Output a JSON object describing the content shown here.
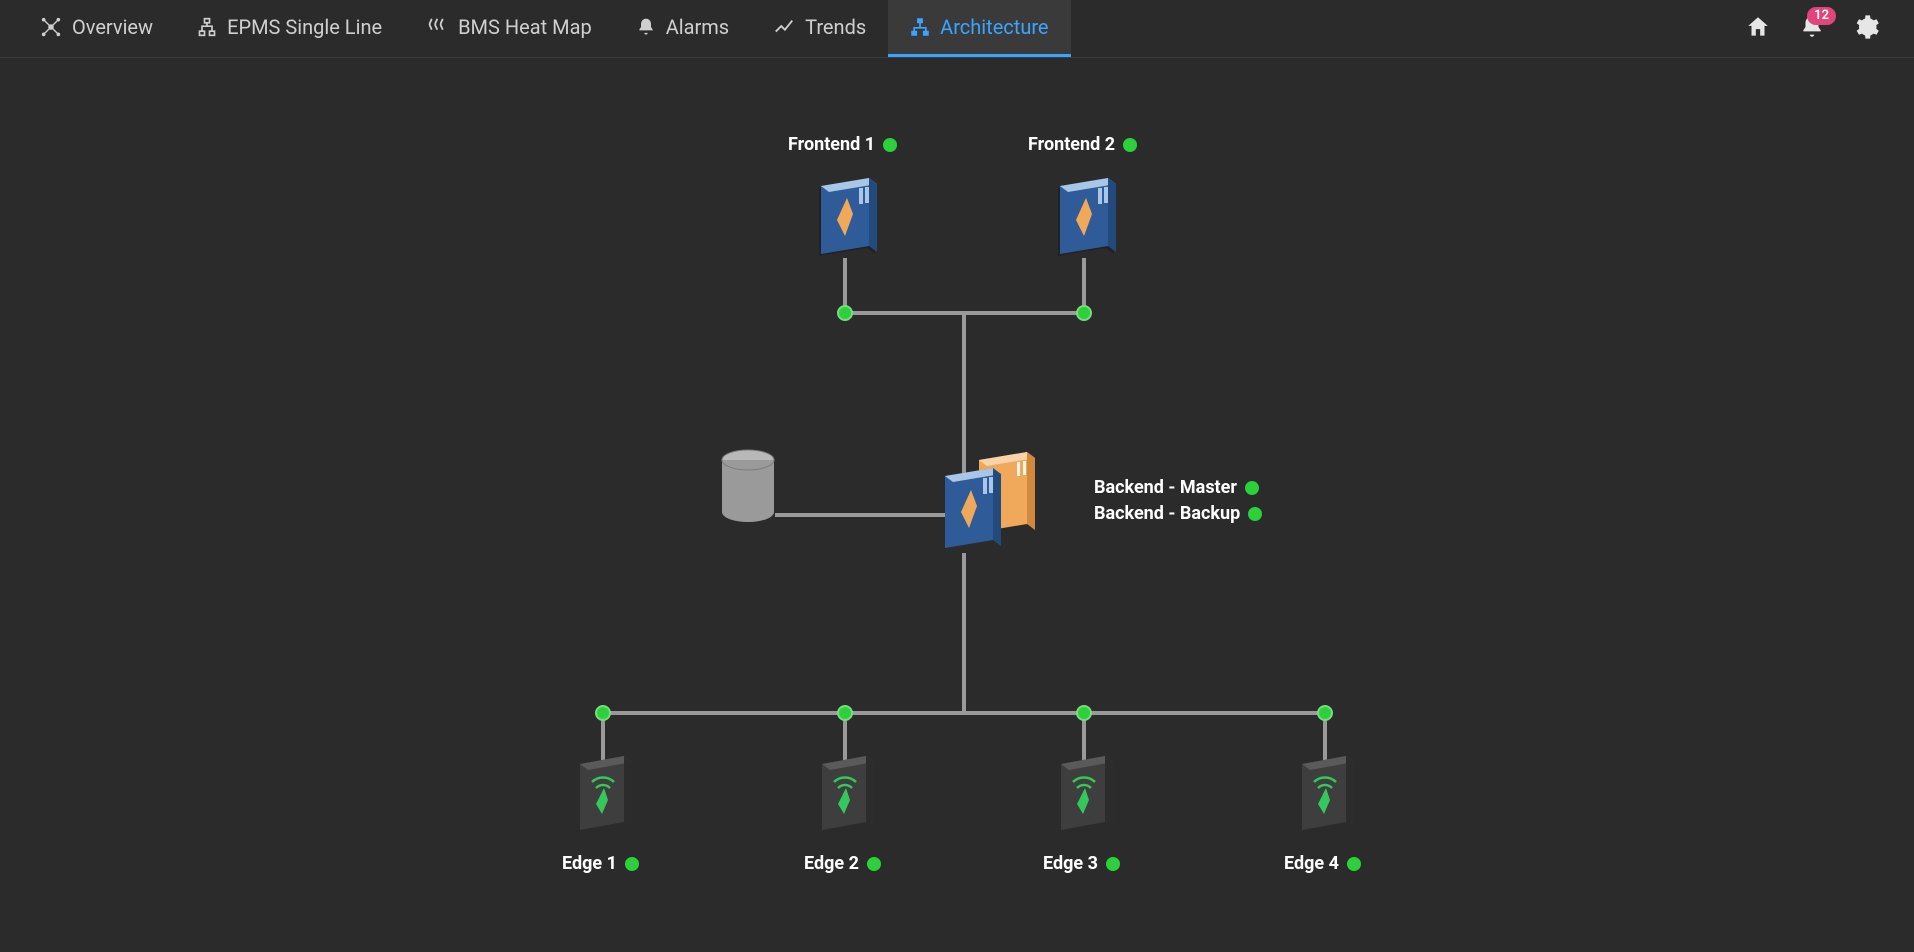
{
  "tabs": [
    {
      "label": "Overview",
      "icon": "overview"
    },
    {
      "label": "EPMS Single Line",
      "icon": "singleline"
    },
    {
      "label": "BMS Heat Map",
      "icon": "heat"
    },
    {
      "label": "Alarms",
      "icon": "bell"
    },
    {
      "label": "Trends",
      "icon": "trend"
    },
    {
      "label": "Architecture",
      "icon": "arch"
    }
  ],
  "active_tab_index": 5,
  "alert_badge": "12",
  "nodes": {
    "frontend1": {
      "label": "Frontend 1",
      "status": "ok"
    },
    "frontend2": {
      "label": "Frontend 2",
      "status": "ok"
    },
    "backend_master": {
      "label": "Backend - Master",
      "status": "ok"
    },
    "backend_backup": {
      "label": "Backend - Backup",
      "status": "ok"
    },
    "edges": [
      {
        "label": "Edge 1",
        "status": "ok"
      },
      {
        "label": "Edge 2",
        "status": "ok"
      },
      {
        "label": "Edge 3",
        "status": "ok"
      },
      {
        "label": "Edge 4",
        "status": "ok"
      }
    ]
  },
  "colors": {
    "bg": "#2b2b2b",
    "accent": "#3ba4ff",
    "status_ok": "#2bd13a",
    "badge": "#e0457b",
    "server_body": "#2f5c99",
    "server_top": "#a9c6e6",
    "server_alt": "#f0a95b",
    "edge_body": "#3e3e3e",
    "edge_accent": "#34c759"
  }
}
